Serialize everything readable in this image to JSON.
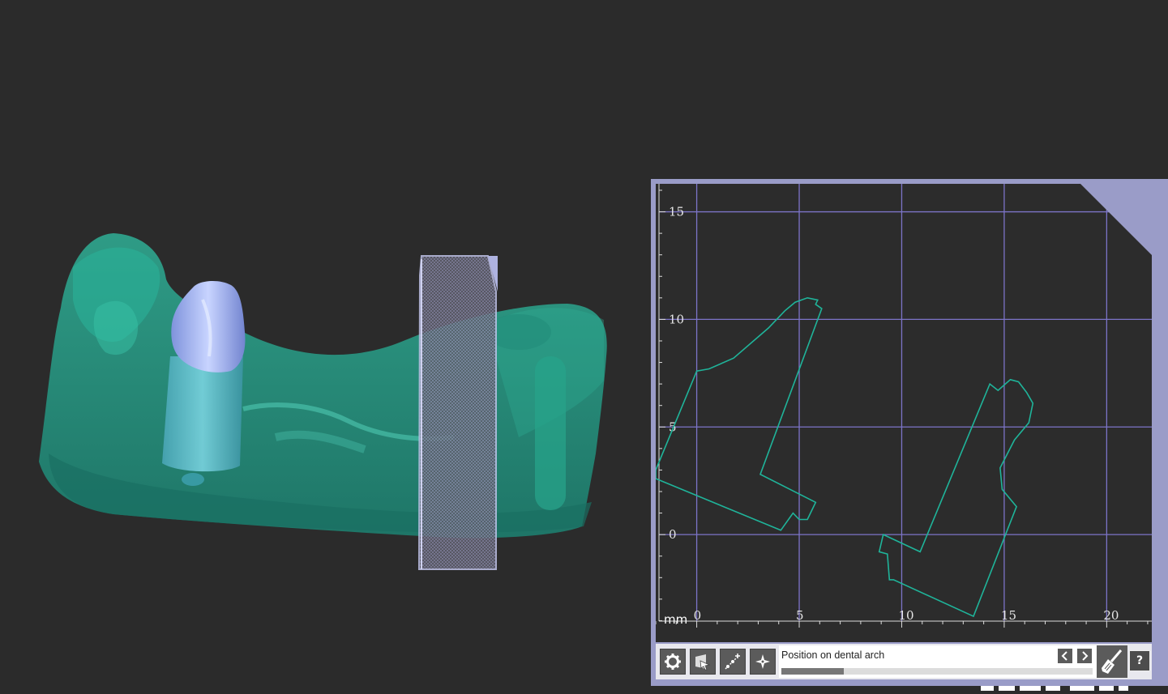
{
  "toolbar": {
    "status_text": "Position on dental arch",
    "progress": 0.2,
    "help_label": "?",
    "icons": [
      "gear-icon",
      "cut-view-icon",
      "add-point-icon",
      "center-icon",
      "chevron-left-icon",
      "chevron-right-icon",
      "broom-icon"
    ]
  },
  "chart_data": {
    "type": "line",
    "unit_label": "mm",
    "x_ticks": [
      "0",
      "5",
      "10",
      "15",
      "20"
    ],
    "y_ticks": [
      "0",
      "5",
      "10",
      "15"
    ],
    "xlim": [
      -2,
      22.2
    ],
    "ylim": [
      -5,
      16.3
    ],
    "grid": true,
    "series": [
      {
        "values": [
          [
            -2,
            3
          ],
          [
            0,
            7.6
          ],
          [
            0.6,
            7.7
          ],
          [
            1.8,
            8.2
          ],
          [
            3.5,
            9.6
          ],
          [
            4.3,
            10.4
          ],
          [
            4.8,
            10.8
          ],
          [
            5.4,
            11
          ],
          [
            5.9,
            10.9
          ],
          [
            5.8,
            10.7
          ],
          [
            6.1,
            10.5
          ],
          [
            3.1,
            2.8
          ],
          [
            5.8,
            1.5
          ],
          [
            5.4,
            0.7
          ],
          [
            5,
            0.7
          ],
          [
            4.7,
            1
          ],
          [
            4.1,
            0.2
          ],
          [
            -2,
            2.6
          ]
        ],
        "color": "#1fb49a"
      },
      {
        "values": [
          [
            9.1,
            0
          ],
          [
            10.9,
            -0.8
          ],
          [
            14.3,
            7
          ],
          [
            14.7,
            6.7
          ],
          [
            15.3,
            7.2
          ],
          [
            15.7,
            7.1
          ],
          [
            16.1,
            6.6
          ],
          [
            16.4,
            6.1
          ],
          [
            16.2,
            5.2
          ],
          [
            15.5,
            4.4
          ],
          [
            14.8,
            3.1
          ],
          [
            14.9,
            2.1
          ],
          [
            15.6,
            1.3
          ],
          [
            13.5,
            -3.8
          ],
          [
            9.6,
            -2.1
          ],
          [
            9.4,
            -2.1
          ],
          [
            9.3,
            -0.9
          ],
          [
            8.9,
            -0.8
          ]
        ],
        "color": "#1fb49a"
      }
    ]
  },
  "colors": {
    "background": "#2b2b2b",
    "panel_frame": "#9a9cc8",
    "grid": "#7c74c8",
    "model": "#1fb49a",
    "implant": "#8b9fe6"
  }
}
